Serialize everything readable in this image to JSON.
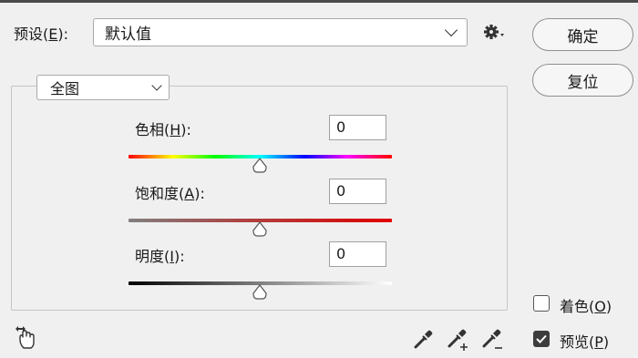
{
  "preset": {
    "label": "预设",
    "key": "E",
    "value": "默认值"
  },
  "buttons": {
    "ok": "确定",
    "reset": "复位"
  },
  "channel": {
    "value": "全图"
  },
  "sliders": [
    {
      "label": "色相",
      "key": "H",
      "value": "0",
      "level": 0.5
    },
    {
      "label": "饱和度",
      "key": "A",
      "value": "0",
      "level": 0.5
    },
    {
      "label": "明度",
      "key": "I",
      "value": "0",
      "level": 0.5
    }
  ],
  "options": {
    "colorize": {
      "label": "着色",
      "key": "O",
      "checked": false
    },
    "preview": {
      "label": "预览",
      "key": "P",
      "checked": true
    }
  },
  "icons": {
    "settings": "gear-icon",
    "targeted_adjust": "hand-scrubby-icon",
    "eyedroppers": [
      "eyedropper-icon",
      "eyedropper-add-icon",
      "eyedropper-subtract-icon"
    ]
  }
}
